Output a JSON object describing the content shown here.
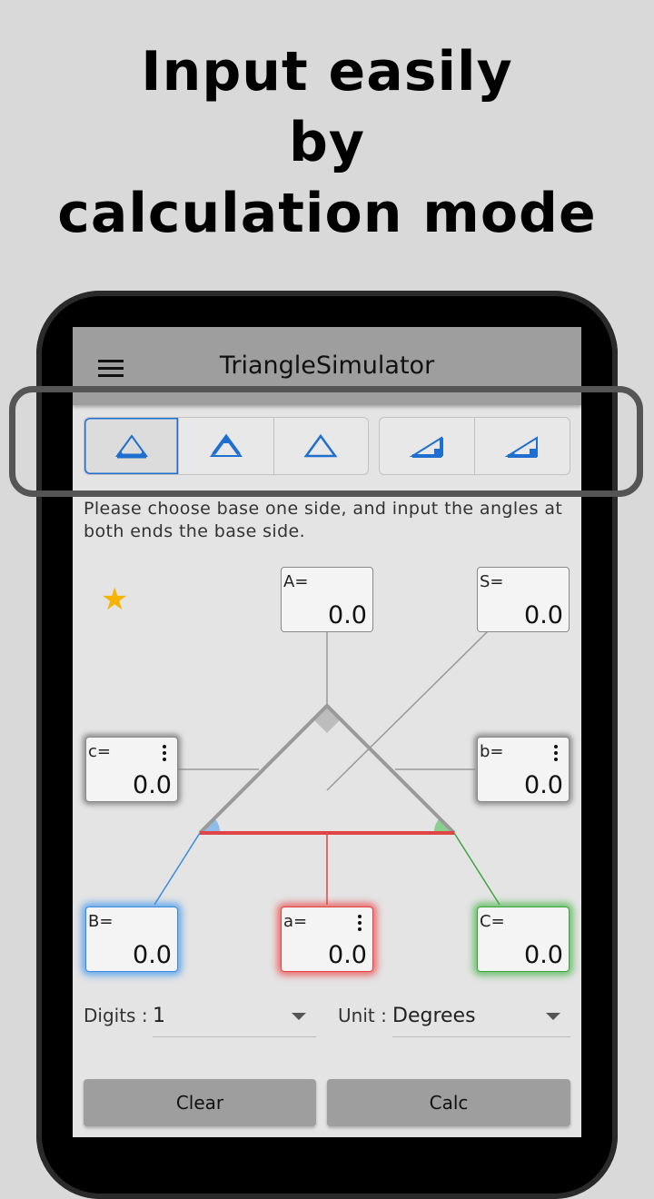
{
  "headline": {
    "line1": "Input easily",
    "line2": "by",
    "line3": "calculation mode"
  },
  "app": {
    "title": "TriangleSimulator"
  },
  "modes": [
    {
      "name": "base-two-angles",
      "selected": true
    },
    {
      "name": "two-sides-angle",
      "selected": false
    },
    {
      "name": "three-sides",
      "selected": false
    },
    {
      "name": "right-two-sides",
      "selected": false
    },
    {
      "name": "right-side-angle",
      "selected": false
    }
  ],
  "hint": "Please choose base one side, and input the angles at both ends the base side.",
  "fields": {
    "A": {
      "label": "A=",
      "value": "0.0"
    },
    "S": {
      "label": "S=",
      "value": "0.0"
    },
    "c": {
      "label": "c=",
      "value": "0.0"
    },
    "b": {
      "label": "b=",
      "value": "0.0"
    },
    "B": {
      "label": "B=",
      "value": "0.0"
    },
    "a": {
      "label": "a=",
      "value": "0.0"
    },
    "C": {
      "label": "C=",
      "value": "0.0"
    }
  },
  "settings": {
    "digits_label": "Digits :",
    "digits_value": "1",
    "unit_label": "Unit :",
    "unit_value": "Degrees"
  },
  "buttons": {
    "clear": "Clear",
    "calc": "Calc"
  },
  "colors": {
    "accent": "#1e6fd0",
    "star": "#f6b400",
    "base": "#e04444",
    "angleB": "#3a8be0",
    "angleC": "#3ca43c"
  }
}
